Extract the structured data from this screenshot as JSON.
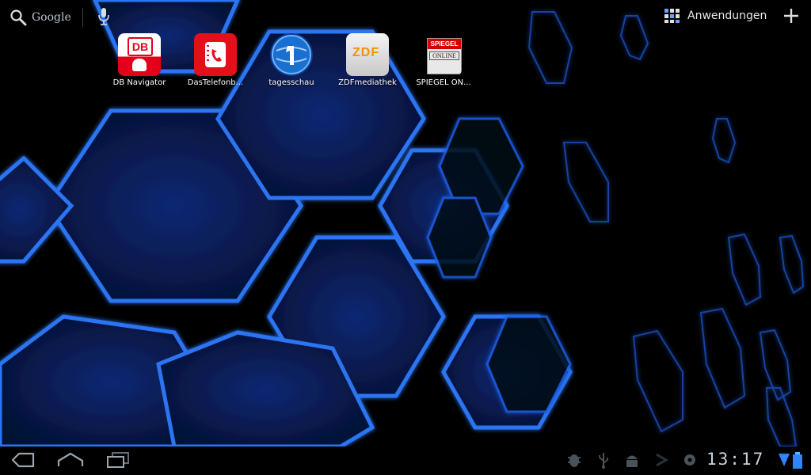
{
  "search": {
    "label": "Google"
  },
  "header": {
    "apps_label": "Anwendungen"
  },
  "shortcuts": [
    {
      "label": "DB Navigator",
      "icon": "db-navigator-icon"
    },
    {
      "label": "DasTelefonb...",
      "icon": "das-telefonbuch-icon"
    },
    {
      "label": "tagesschau",
      "icon": "tagesschau-icon"
    },
    {
      "label": "ZDFmediathek",
      "icon": "zdf-mediathek-icon"
    },
    {
      "label": "SPIEGEL ON...",
      "icon": "spiegel-online-icon"
    }
  ],
  "icon_text": {
    "db": "DB",
    "zdf": "ZDF",
    "spiegel_top": "SPIEGEL",
    "spiegel_bottom": "ONLINE"
  },
  "statusbar": {
    "time": "13:17"
  },
  "colors": {
    "accent": "#1f6bff",
    "wallpaper": "#0a1a4d",
    "bar": "#000000"
  }
}
